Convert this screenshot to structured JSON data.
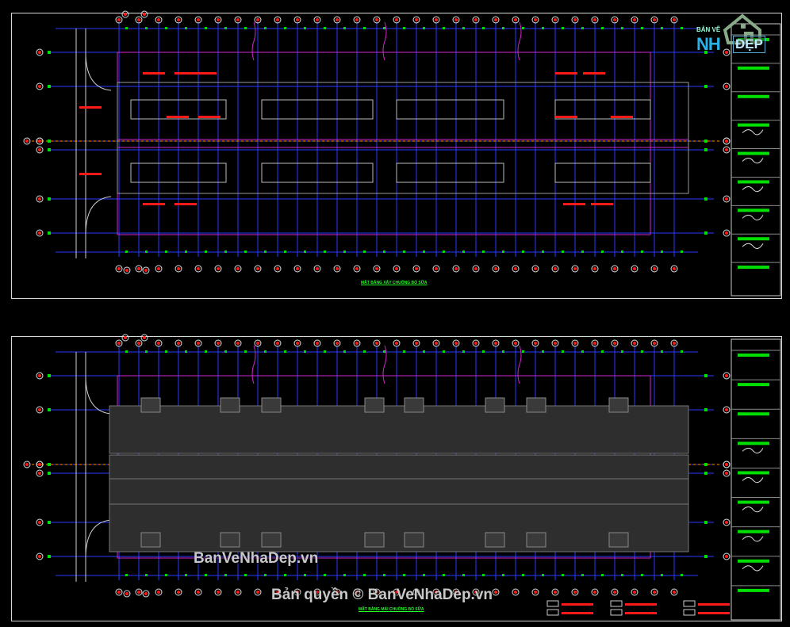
{
  "logo": {
    "small_text": "BẢN VẼ",
    "big_text": "NH",
    "suffix_text": "ĐẸP"
  },
  "watermarks": {
    "site": "BanVeNhaDep.vn",
    "copyright": "Bản quyền © BanVeNhaDep.vn"
  },
  "drawings": {
    "top_title": "MẶT BẰNG XÂY CHUỒNG BÒ SỮA",
    "bottom_title": "MẶT BẰNG MÁI CHUỒNG BÒ SỮA"
  },
  "colors": {
    "background": "#000000",
    "frame": "#d8d8d8",
    "grid_blue": "#2a3cff",
    "wall_gray": "#9a9a9a",
    "magenta": "#d028d0",
    "green_marker": "#00e000",
    "red_marker": "#ff1a1a",
    "axis_orange": "#ff8a00",
    "roof_fill": "#2e2e2e",
    "title_green": "#22ff22"
  }
}
